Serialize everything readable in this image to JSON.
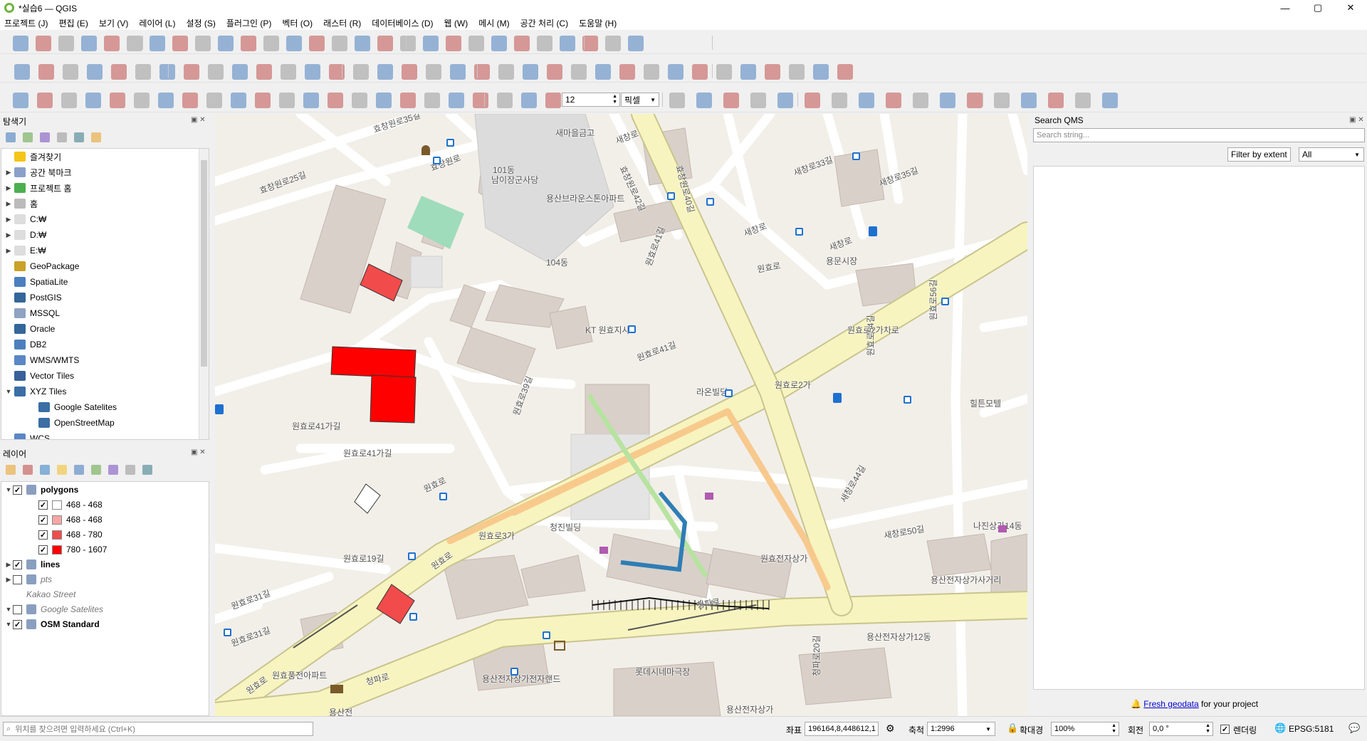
{
  "window": {
    "title": "*실습6 — QGIS",
    "minimize": "—",
    "maximize": "▢",
    "close": "✕"
  },
  "menu": [
    "프로젝트 (J)",
    "편집 (E)",
    "보기 (V)",
    "레이어 (L)",
    "설정 (S)",
    "플러그인 (P)",
    "벡터 (O)",
    "래스터 (R)",
    "데이터베이스 (D)",
    "웹 (W)",
    "메시 (M)",
    "공간 처리 (C)",
    "도움말 (H)"
  ],
  "digitizing": {
    "snap_tolerance": "12",
    "snap_unit": "픽셀"
  },
  "browser": {
    "title": "탐색기",
    "items": [
      {
        "label": "즐겨찾기",
        "icon": "star-icon",
        "color": "#f5c518",
        "expand": ""
      },
      {
        "label": "공간 북마크",
        "icon": "bookmark-icon",
        "color": "#8aa0c8",
        "expand": "▶"
      },
      {
        "label": "프로젝트 홈",
        "icon": "project-home-icon",
        "color": "#4caf50",
        "expand": "▶"
      },
      {
        "label": "홈",
        "icon": "home-icon",
        "color": "#bbbbbb",
        "expand": "▶"
      },
      {
        "label": "C:₩",
        "icon": "folder-icon",
        "color": "#dddddd",
        "expand": "▶"
      },
      {
        "label": "D:₩",
        "icon": "folder-icon",
        "color": "#dddddd",
        "expand": "▶"
      },
      {
        "label": "E:₩",
        "icon": "folder-icon",
        "color": "#dddddd",
        "expand": "▶"
      },
      {
        "label": "GeoPackage",
        "icon": "geopackage-icon",
        "color": "#c9a227",
        "expand": ""
      },
      {
        "label": "SpatiaLite",
        "icon": "spatialite-icon",
        "color": "#4a7fbf",
        "expand": ""
      },
      {
        "label": "PostGIS",
        "icon": "postgis-icon",
        "color": "#33669a",
        "expand": ""
      },
      {
        "label": "MSSQL",
        "icon": "mssql-icon",
        "color": "#8fa3c2",
        "expand": ""
      },
      {
        "label": "Oracle",
        "icon": "oracle-icon",
        "color": "#336699",
        "expand": ""
      },
      {
        "label": "DB2",
        "icon": "db2-icon",
        "color": "#4d7fbf",
        "expand": ""
      },
      {
        "label": "WMS/WMTS",
        "icon": "wms-icon",
        "color": "#5a87c6",
        "expand": ""
      },
      {
        "label": "Vector Tiles",
        "icon": "vector-tiles-icon",
        "color": "#3a5f9a",
        "expand": ""
      },
      {
        "label": "XYZ Tiles",
        "icon": "xyz-tiles-icon",
        "color": "#3a6ea5",
        "expand": "▼"
      },
      {
        "label": "Google Satelites",
        "icon": "tiles-icon",
        "color": "#3a6ea5",
        "expand": "",
        "indent": true
      },
      {
        "label": "OpenStreetMap",
        "icon": "tiles-icon",
        "color": "#3a6ea5",
        "expand": "",
        "indent": true
      },
      {
        "label": "WCS",
        "icon": "wcs-icon",
        "color": "#5a87c6",
        "expand": ""
      }
    ]
  },
  "layers": {
    "title": "레이어",
    "items": [
      {
        "name": "polygons",
        "checked": "✓",
        "expand": "▼",
        "bold": true,
        "icon": "polygon-layer-icon"
      },
      {
        "name": "468 - 468",
        "checked": "✓",
        "swatch": "#ffffff",
        "sub": true
      },
      {
        "name": "468 - 468",
        "checked": "✓",
        "swatch": "#f7a6a6",
        "sub": true
      },
      {
        "name": "468 - 780",
        "checked": "✓",
        "swatch": "#f24b4b",
        "sub": true
      },
      {
        "name": "780 - 1607",
        "checked": "✓",
        "swatch": "#ff0000",
        "sub": true
      },
      {
        "name": "lines",
        "checked": "✓",
        "expand": "▶",
        "bold": true,
        "icon": "line-layer-icon"
      },
      {
        "name": "pts",
        "checked": "",
        "expand": "▶",
        "italic": true,
        "icon": "point-layer-icon"
      },
      {
        "name": "Kakao Street",
        "checked": "",
        "expand": "",
        "italic": true,
        "nocheck": true
      },
      {
        "name": "Google Satelites",
        "checked": "",
        "expand": "▼",
        "italic": true,
        "icon": "raster-layer-icon"
      },
      {
        "name": "OSM Standard",
        "checked": "✓",
        "expand": "▼",
        "bold": true,
        "icon": "raster-layer-icon"
      }
    ]
  },
  "qms": {
    "title": "Search QMS",
    "placeholder": "Search string...",
    "filter_btn": "Filter by extent",
    "filter_select": "All",
    "news_link": "Fresh geodata",
    "news_text": " for your project"
  },
  "status": {
    "locator_placeholder": "위치를 찾으려면 입력하세요 (Ctrl+K)",
    "coord_label": "좌표",
    "coord": "196164,8,448612,1",
    "scale_label": "축척",
    "scale": "1:2996",
    "mag_label": "확대경",
    "mag": "100%",
    "rot_label": "회전",
    "rot": "0,0 °",
    "render_label": "렌더링",
    "render_checked": "✓",
    "crs": "EPSG:5181"
  },
  "map": {
    "labels": [
      "효창원로35길",
      "새마을금고",
      "새창로",
      "효창원로",
      "101동",
      "효창원로42길",
      "효창원로40길",
      "새창로33길",
      "새창로35길",
      "남이장군사당",
      "용산브라운스톤아파트",
      "효창원로25길",
      "새창로",
      "용문시장",
      "새창로",
      "원효로",
      "104동",
      "원효로41길",
      "KT 원효지사",
      "원효로2가차로",
      "원효로41길",
      "라온빌딩",
      "원효로2가",
      "원효로54길",
      "원효로56길",
      "힐튼모텔",
      "원효로41가길",
      "원효로41가길",
      "원효로39길",
      "원효로",
      "새창로44길",
      "새창로50길",
      "원효로3가",
      "청진빌딩",
      "원효로19길",
      "원효로",
      "원효로31길",
      "원효로31길",
      "원효전자상가",
      "청파로",
      "용산전자상가사거리",
      "용산전자상가12동",
      "롯데시네마극장",
      "용산전자상가전자랜드",
      "원효풍전아파트",
      "청파로",
      "원효로",
      "나진상가14동",
      "청파로20길",
      "용산전자상가",
      "용산전"
    ]
  }
}
